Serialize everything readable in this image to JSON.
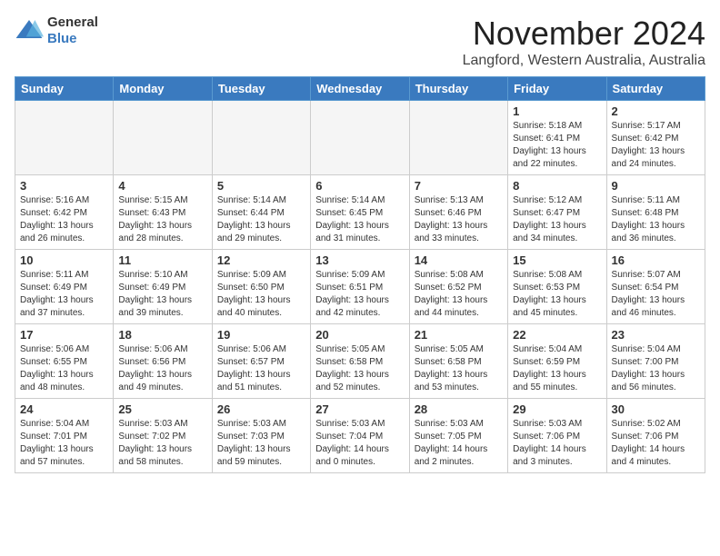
{
  "header": {
    "logo_line1": "General",
    "logo_line2": "Blue",
    "month_title": "November 2024",
    "location": "Langford, Western Australia, Australia"
  },
  "days_of_week": [
    "Sunday",
    "Monday",
    "Tuesday",
    "Wednesday",
    "Thursday",
    "Friday",
    "Saturday"
  ],
  "weeks": [
    [
      {
        "day": "",
        "empty": true
      },
      {
        "day": "",
        "empty": true
      },
      {
        "day": "",
        "empty": true
      },
      {
        "day": "",
        "empty": true
      },
      {
        "day": "",
        "empty": true
      },
      {
        "day": "1",
        "sunrise": "5:18 AM",
        "sunset": "6:41 PM",
        "daylight": "13 hours and 22 minutes."
      },
      {
        "day": "2",
        "sunrise": "5:17 AM",
        "sunset": "6:42 PM",
        "daylight": "13 hours and 24 minutes."
      }
    ],
    [
      {
        "day": "3",
        "sunrise": "5:16 AM",
        "sunset": "6:42 PM",
        "daylight": "13 hours and 26 minutes."
      },
      {
        "day": "4",
        "sunrise": "5:15 AM",
        "sunset": "6:43 PM",
        "daylight": "13 hours and 28 minutes."
      },
      {
        "day": "5",
        "sunrise": "5:14 AM",
        "sunset": "6:44 PM",
        "daylight": "13 hours and 29 minutes."
      },
      {
        "day": "6",
        "sunrise": "5:14 AM",
        "sunset": "6:45 PM",
        "daylight": "13 hours and 31 minutes."
      },
      {
        "day": "7",
        "sunrise": "5:13 AM",
        "sunset": "6:46 PM",
        "daylight": "13 hours and 33 minutes."
      },
      {
        "day": "8",
        "sunrise": "5:12 AM",
        "sunset": "6:47 PM",
        "daylight": "13 hours and 34 minutes."
      },
      {
        "day": "9",
        "sunrise": "5:11 AM",
        "sunset": "6:48 PM",
        "daylight": "13 hours and 36 minutes."
      }
    ],
    [
      {
        "day": "10",
        "sunrise": "5:11 AM",
        "sunset": "6:49 PM",
        "daylight": "13 hours and 37 minutes."
      },
      {
        "day": "11",
        "sunrise": "5:10 AM",
        "sunset": "6:49 PM",
        "daylight": "13 hours and 39 minutes."
      },
      {
        "day": "12",
        "sunrise": "5:09 AM",
        "sunset": "6:50 PM",
        "daylight": "13 hours and 40 minutes."
      },
      {
        "day": "13",
        "sunrise": "5:09 AM",
        "sunset": "6:51 PM",
        "daylight": "13 hours and 42 minutes."
      },
      {
        "day": "14",
        "sunrise": "5:08 AM",
        "sunset": "6:52 PM",
        "daylight": "13 hours and 44 minutes."
      },
      {
        "day": "15",
        "sunrise": "5:08 AM",
        "sunset": "6:53 PM",
        "daylight": "13 hours and 45 minutes."
      },
      {
        "day": "16",
        "sunrise": "5:07 AM",
        "sunset": "6:54 PM",
        "daylight": "13 hours and 46 minutes."
      }
    ],
    [
      {
        "day": "17",
        "sunrise": "5:06 AM",
        "sunset": "6:55 PM",
        "daylight": "13 hours and 48 minutes."
      },
      {
        "day": "18",
        "sunrise": "5:06 AM",
        "sunset": "6:56 PM",
        "daylight": "13 hours and 49 minutes."
      },
      {
        "day": "19",
        "sunrise": "5:06 AM",
        "sunset": "6:57 PM",
        "daylight": "13 hours and 51 minutes."
      },
      {
        "day": "20",
        "sunrise": "5:05 AM",
        "sunset": "6:58 PM",
        "daylight": "13 hours and 52 minutes."
      },
      {
        "day": "21",
        "sunrise": "5:05 AM",
        "sunset": "6:58 PM",
        "daylight": "13 hours and 53 minutes."
      },
      {
        "day": "22",
        "sunrise": "5:04 AM",
        "sunset": "6:59 PM",
        "daylight": "13 hours and 55 minutes."
      },
      {
        "day": "23",
        "sunrise": "5:04 AM",
        "sunset": "7:00 PM",
        "daylight": "13 hours and 56 minutes."
      }
    ],
    [
      {
        "day": "24",
        "sunrise": "5:04 AM",
        "sunset": "7:01 PM",
        "daylight": "13 hours and 57 minutes."
      },
      {
        "day": "25",
        "sunrise": "5:03 AM",
        "sunset": "7:02 PM",
        "daylight": "13 hours and 58 minutes."
      },
      {
        "day": "26",
        "sunrise": "5:03 AM",
        "sunset": "7:03 PM",
        "daylight": "13 hours and 59 minutes."
      },
      {
        "day": "27",
        "sunrise": "5:03 AM",
        "sunset": "7:04 PM",
        "daylight": "14 hours and 0 minutes."
      },
      {
        "day": "28",
        "sunrise": "5:03 AM",
        "sunset": "7:05 PM",
        "daylight": "14 hours and 2 minutes."
      },
      {
        "day": "29",
        "sunrise": "5:03 AM",
        "sunset": "7:06 PM",
        "daylight": "14 hours and 3 minutes."
      },
      {
        "day": "30",
        "sunrise": "5:02 AM",
        "sunset": "7:06 PM",
        "daylight": "14 hours and 4 minutes."
      }
    ]
  ]
}
